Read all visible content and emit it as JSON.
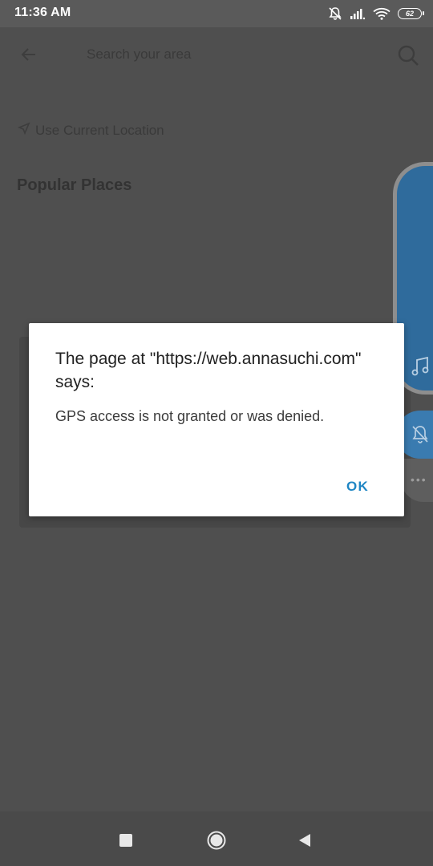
{
  "status_bar": {
    "time": "11:36 AM",
    "battery": "62",
    "icons": [
      "mute-icon",
      "signal-icon",
      "wifi-icon",
      "battery-icon"
    ]
  },
  "background_page": {
    "search_placeholder": "Search your area",
    "current_location_label": "Use Current Location",
    "popular_heading": "Popular Places"
  },
  "dialog": {
    "title": "The page at \"https://web.annasuchi.com\" says:",
    "message": "GPS access is not granted or was denied.",
    "ok_label": "OK",
    "accent_color": "#1f86c4"
  },
  "floating_widget": {
    "icons": [
      "music-note-icon",
      "bell-off-icon",
      "more-icon"
    ],
    "color": "#2f6b9c"
  },
  "nav_bar": {
    "icons": [
      "recent-apps-icon",
      "home-icon",
      "back-icon"
    ]
  }
}
